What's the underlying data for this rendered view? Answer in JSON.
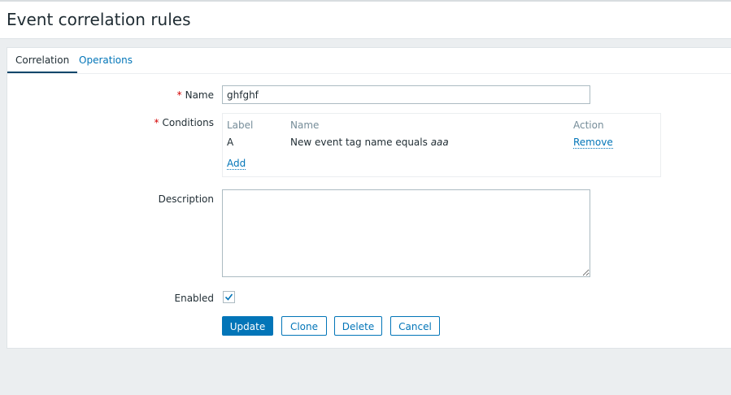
{
  "page": {
    "title": "Event correlation rules"
  },
  "tabs": [
    {
      "label": "Correlation",
      "active": true
    },
    {
      "label": "Operations",
      "active": false
    }
  ],
  "form": {
    "required_mark": "*",
    "name_label": "Name",
    "name_value": "ghfghf",
    "conditions_label": "Conditions",
    "conditions": {
      "headers": {
        "label": "Label",
        "name": "Name",
        "action": "Action"
      },
      "rows": [
        {
          "label": "A",
          "name_prefix": "New event tag name equals ",
          "name_value": "aaa",
          "action": "Remove"
        }
      ],
      "add_label": "Add"
    },
    "description_label": "Description",
    "description_value": "",
    "enabled_label": "Enabled",
    "enabled": true
  },
  "buttons": {
    "update": "Update",
    "clone": "Clone",
    "delete": "Delete",
    "cancel": "Cancel"
  },
  "colors": {
    "accent": "#0275b8",
    "required": "#d40000",
    "background": "#ebeef0"
  },
  "icons": {
    "enabled_check": "checkmark-icon"
  }
}
